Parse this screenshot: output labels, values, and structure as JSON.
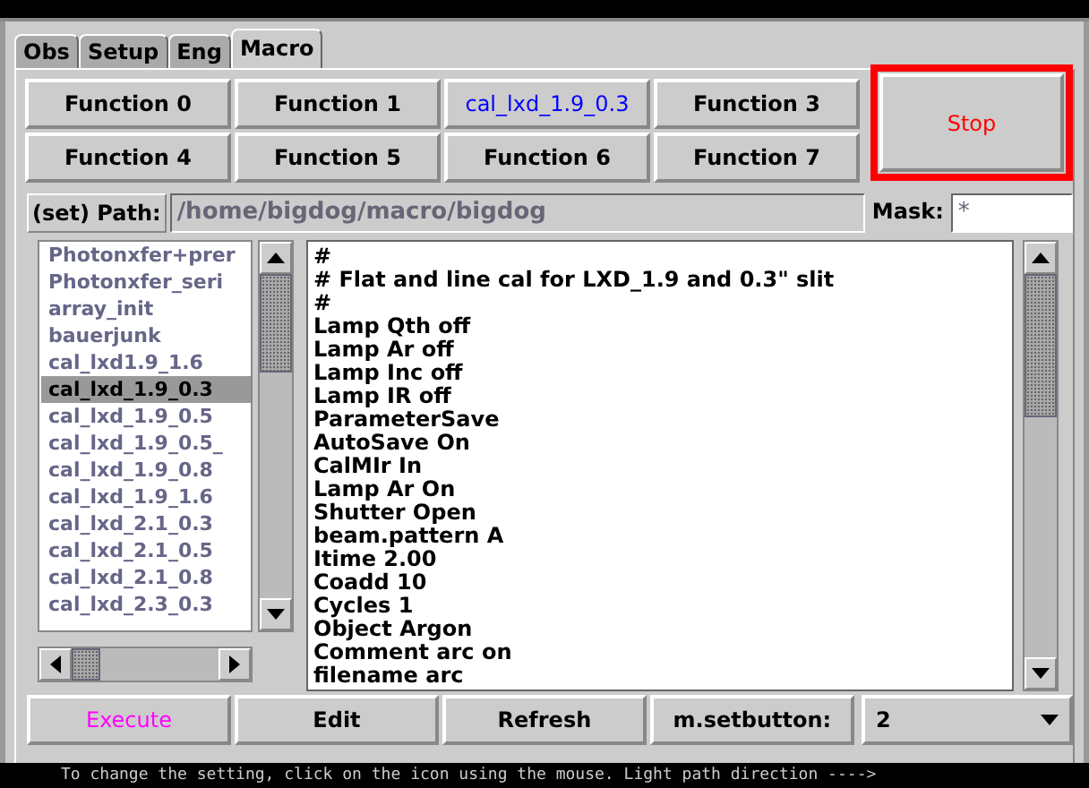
{
  "tabs": [
    {
      "label": "Obs",
      "selected": false
    },
    {
      "label": "Setup",
      "selected": false
    },
    {
      "label": "Eng",
      "selected": false
    },
    {
      "label": "Macro",
      "selected": true
    }
  ],
  "function_buttons": [
    {
      "label": "Function 0",
      "kind": "plain"
    },
    {
      "label": "Function 1",
      "kind": "plain"
    },
    {
      "label": "cal_lxd_1.9_0.3",
      "kind": "assigned"
    },
    {
      "label": "Function 3",
      "kind": "plain"
    },
    {
      "label": "Function 4",
      "kind": "plain"
    },
    {
      "label": "Function 5",
      "kind": "plain"
    },
    {
      "label": "Function 6",
      "kind": "plain"
    },
    {
      "label": "Function 7",
      "kind": "plain"
    }
  ],
  "stop_button": {
    "label": "Stop"
  },
  "path": {
    "label": "(set) Path:",
    "value": "/home/bigdog/macro/bigdog"
  },
  "mask": {
    "label": "Mask:",
    "value": "*"
  },
  "macro_list": [
    {
      "name": "Photonxfer+prer",
      "selected": false
    },
    {
      "name": "Photonxfer_seri",
      "selected": false
    },
    {
      "name": "array_init",
      "selected": false
    },
    {
      "name": "bauerjunk",
      "selected": false
    },
    {
      "name": "cal_lxd1.9_1.6",
      "selected": false
    },
    {
      "name": "cal_lxd_1.9_0.3",
      "selected": true
    },
    {
      "name": "cal_lxd_1.9_0.5",
      "selected": false
    },
    {
      "name": "cal_lxd_1.9_0.5_",
      "selected": false
    },
    {
      "name": "cal_lxd_1.9_0.8",
      "selected": false
    },
    {
      "name": "cal_lxd_1.9_1.6",
      "selected": false
    },
    {
      "name": "cal_lxd_2.1_0.3",
      "selected": false
    },
    {
      "name": "cal_lxd_2.1_0.5",
      "selected": false
    },
    {
      "name": "cal_lxd_2.1_0.8",
      "selected": false
    },
    {
      "name": "cal_lxd_2.3_0.3",
      "selected": false
    }
  ],
  "macro_text": [
    "#",
    "# Flat and line cal for LXD_1.9 and 0.3\" slit",
    "#",
    "Lamp Qth off",
    "Lamp Ar off",
    "Lamp Inc off",
    "Lamp IR off",
    "ParameterSave",
    "AutoSave On",
    "CalMIr In",
    "Lamp Ar On",
    "Shutter Open",
    "beam.pattern A",
    "Itime 2.00",
    "Coadd 10",
    "Cycles 1",
    "Object Argon",
    "Comment arc on",
    "filename arc"
  ],
  "bottom_buttons": [
    {
      "label": "Execute",
      "kind": "execute"
    },
    {
      "label": "Edit",
      "kind": "plain"
    },
    {
      "label": "Refresh",
      "kind": "plain"
    },
    {
      "label": "m.setbutton:",
      "kind": "plain"
    }
  ],
  "setbutton_select": {
    "value": "2"
  },
  "status_bar": "To change the setting, click on the icon using the mouse. Light path direction ---->"
}
